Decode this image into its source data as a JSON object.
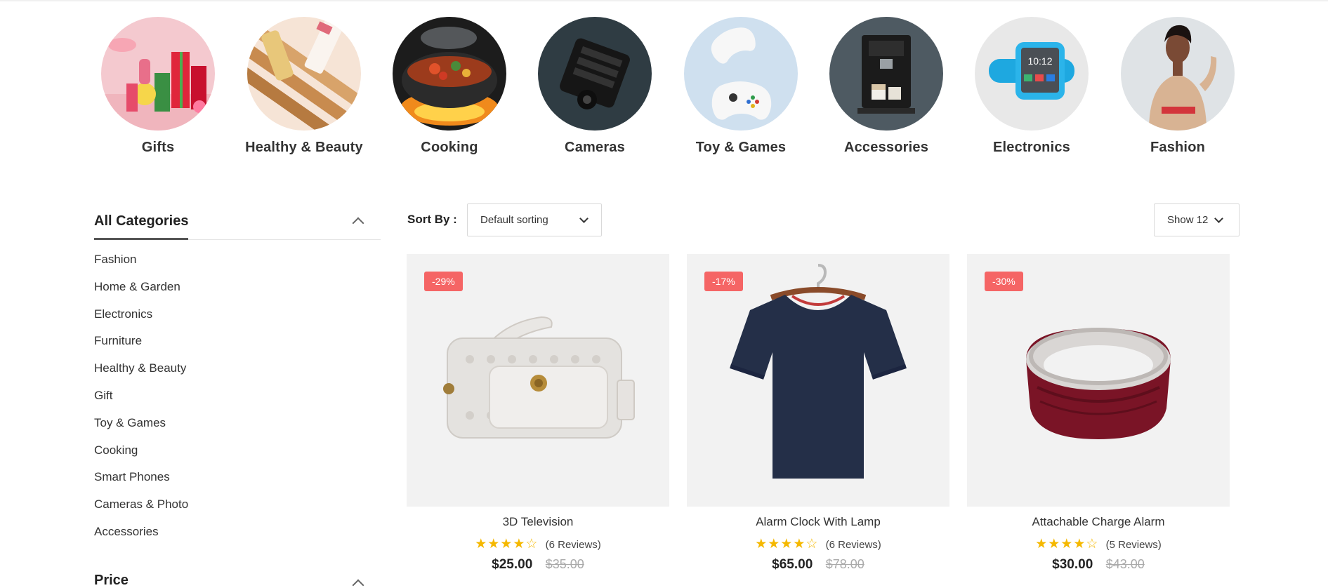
{
  "categories_row": [
    {
      "label": "Gifts",
      "icon": "gifts-image"
    },
    {
      "label": "Healthy & Beauty",
      "icon": "beauty-image"
    },
    {
      "label": "Cooking",
      "icon": "cooking-image"
    },
    {
      "label": "Cameras",
      "icon": "camera-image"
    },
    {
      "label": "Toy & Games",
      "icon": "gamepad-image"
    },
    {
      "label": "Accessories",
      "icon": "coffee-machine-image"
    },
    {
      "label": "Electronics",
      "icon": "smartwatch-image"
    },
    {
      "label": "Fashion",
      "icon": "fashion-model-image"
    }
  ],
  "sidebar": {
    "title": "All Categories",
    "items": [
      "Fashion",
      "Home & Garden",
      "Electronics",
      "Furniture",
      "Healthy & Beauty",
      "Gift",
      "Toy & Games",
      "Cooking",
      "Smart Phones",
      "Cameras & Photo",
      "Accessories"
    ],
    "price_title": "Price"
  },
  "toolbar": {
    "sort_label": "Sort By :",
    "sort_value": "Default sorting",
    "show_value": "Show 12"
  },
  "products": [
    {
      "badge": "-29%",
      "name": "3D Television",
      "rating": 4,
      "reviews": "(6 Reviews)",
      "price": "$25.00",
      "old_price": "$35.00",
      "image": "handbag-image"
    },
    {
      "badge": "-17%",
      "name": "Alarm Clock With Lamp",
      "rating": 4,
      "reviews": "(6 Reviews)",
      "price": "$65.00",
      "old_price": "$78.00",
      "image": "tshirt-image"
    },
    {
      "badge": "-30%",
      "name": "Attachable Charge Alarm",
      "rating": 4,
      "reviews": "(5 Reviews)",
      "price": "$30.00",
      "old_price": "$43.00",
      "image": "headband-image"
    }
  ],
  "colors": {
    "badge": "#f56565",
    "star": "#f5b800",
    "image_bg": "#f2f2f2"
  }
}
